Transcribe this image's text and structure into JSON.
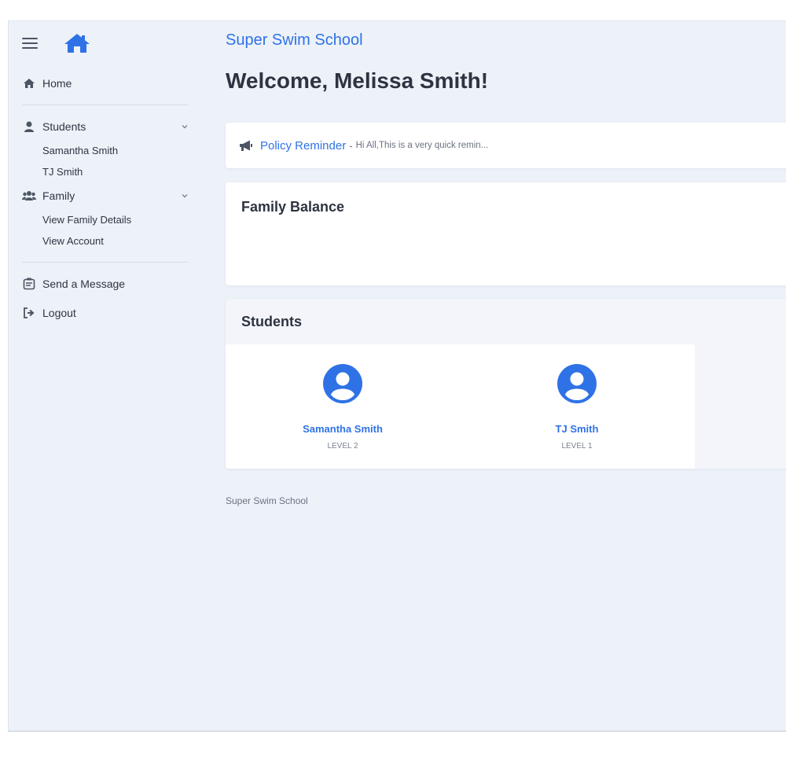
{
  "sidebar": {
    "items": [
      {
        "label": "Home",
        "icon": "home-icon"
      },
      {
        "label": "Students",
        "icon": "user-icon",
        "children": [
          "Samantha Smith",
          "TJ Smith"
        ]
      },
      {
        "label": "Family",
        "icon": "users-icon",
        "children": [
          "View Family Details",
          "View Account"
        ]
      },
      {
        "label": "Send a Message",
        "icon": "message-icon"
      },
      {
        "label": "Logout",
        "icon": "logout-icon"
      }
    ]
  },
  "header": {
    "school_name": "Super Swim School",
    "welcome": "Welcome, Melissa Smith!"
  },
  "policy": {
    "title": "Policy Reminder",
    "separator": "-",
    "excerpt": "Hi All,This is a very quick remin..."
  },
  "balance": {
    "title": "Family Balance"
  },
  "students": {
    "title": "Students",
    "list": [
      {
        "name": "Samantha Smith",
        "level": "LEVEL 2"
      },
      {
        "name": "TJ Smith",
        "level": "LEVEL 1"
      }
    ]
  },
  "footer": {
    "text": "Super Swim School"
  },
  "colors": {
    "accent": "#2f72e6",
    "background": "#edf1f8",
    "card": "#ffffff",
    "text": "#2d3340"
  }
}
